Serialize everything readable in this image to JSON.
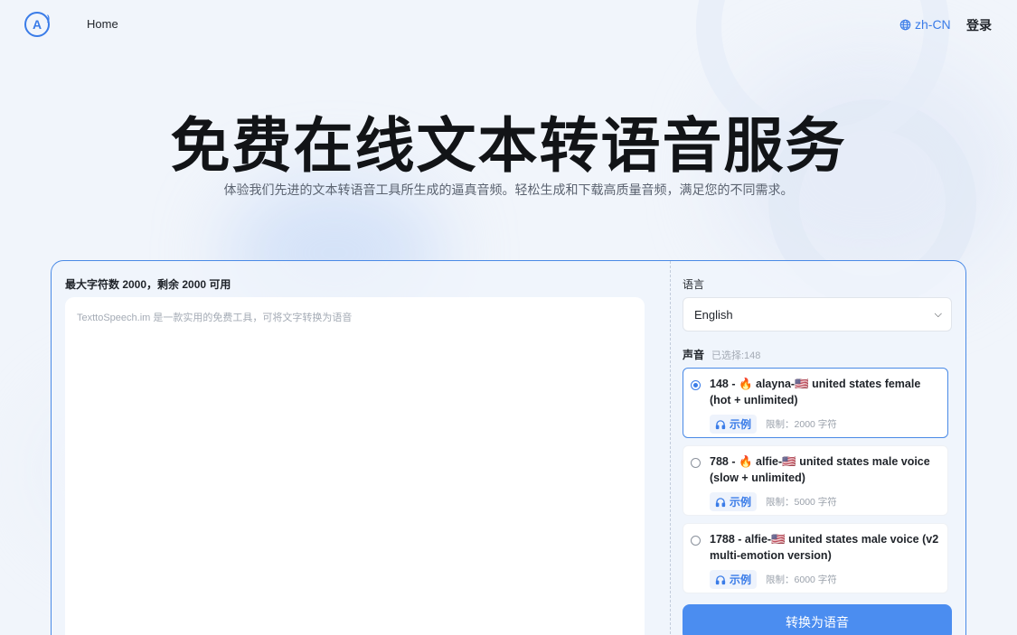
{
  "header": {
    "logo_text": "A",
    "home_label": "Home",
    "language_label": "zh-CN",
    "login_label": "登录"
  },
  "hero": {
    "title": "免费在线文本转语音服务",
    "subtitle": "体验我们先进的文本转语音工具所生成的逼真音频。轻松生成和下载高质量音频，满足您的不同需求。"
  },
  "editor": {
    "char_count_text": "最大字符数 2000，剩余 2000 可用",
    "placeholder": "TexttoSpeech.im 是一款实用的免费工具，可将文字转换为语音"
  },
  "settings": {
    "language_label": "语言",
    "language_value": "English",
    "voice_label": "声音",
    "voice_selected_text": "已选择:148",
    "voices": [
      {
        "name": "148 - 🔥 alayna-🇺🇸 united states female (hot + unlimited)",
        "sample_label": "示例",
        "limit_text": "限制：2000 字符",
        "selected": true
      },
      {
        "name": "788 - 🔥 alfie-🇺🇸  united states male voice (slow + unlimited)",
        "sample_label": "示例",
        "limit_text": "限制：5000 字符",
        "selected": false
      },
      {
        "name": "1788 - alfie-🇺🇸  united states male voice (v2 multi-emotion version)",
        "sample_label": "示例",
        "limit_text": "限制：6000 字符",
        "selected": false
      }
    ],
    "convert_label": "转换为语音"
  },
  "colors": {
    "accent": "#3a7ce8",
    "button": "#4b8df0",
    "panel_border": "#4a8ae6"
  }
}
